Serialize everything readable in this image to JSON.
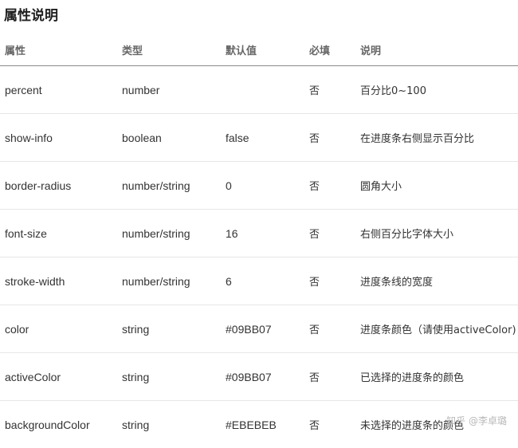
{
  "title": "属性说明",
  "table": {
    "headers": [
      "属性",
      "类型",
      "默认值",
      "必填",
      "说明"
    ],
    "rows": [
      [
        "percent",
        "number",
        "",
        "否",
        "百分比0~100"
      ],
      [
        "show-info",
        "boolean",
        "false",
        "否",
        "在进度条右侧显示百分比"
      ],
      [
        "border-radius",
        "number/string",
        "0",
        "否",
        "圆角大小"
      ],
      [
        "font-size",
        "number/string",
        "16",
        "否",
        "右侧百分比字体大小"
      ],
      [
        "stroke-width",
        "number/string",
        "6",
        "否",
        "进度条线的宽度"
      ],
      [
        "color",
        "string",
        "#09BB07",
        "否",
        "进度条颜色（请使用activeColor)"
      ],
      [
        "activeColor",
        "string",
        "#09BB07",
        "否",
        "已选择的进度条的颜色"
      ],
      [
        "backgroundColor",
        "string",
        "#EBEBEB",
        "否",
        "未选择的进度条的颜色"
      ]
    ]
  },
  "watermark": "知乎 @李卓璐"
}
